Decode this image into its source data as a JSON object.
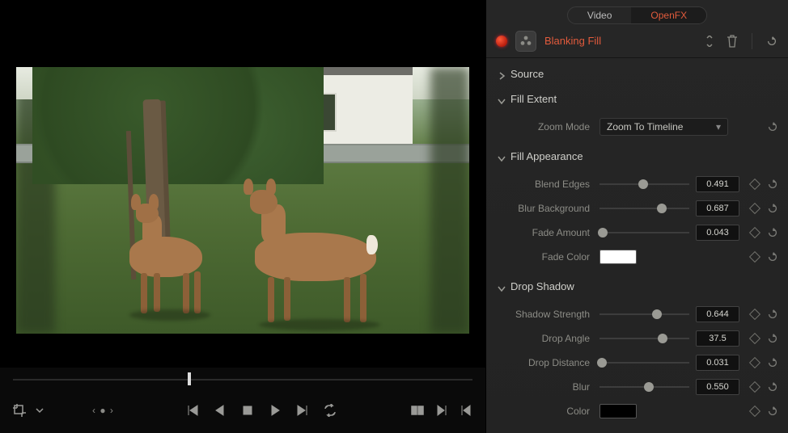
{
  "tabs": {
    "video": "Video",
    "openfx": "OpenFX"
  },
  "effect": {
    "name": "Blanking Fill"
  },
  "sections": {
    "source": {
      "title": "Source",
      "expanded": false
    },
    "fill_extent": {
      "title": "Fill Extent",
      "expanded": true
    },
    "fill_appearance": {
      "title": "Fill Appearance",
      "expanded": true
    },
    "drop_shadow": {
      "title": "Drop Shadow",
      "expanded": true
    }
  },
  "fill_extent": {
    "zoom_mode": {
      "label": "Zoom Mode",
      "value": "Zoom To Timeline"
    }
  },
  "fill_appearance": {
    "blend_edges": {
      "label": "Blend Edges",
      "value": "0.491",
      "pct": 49
    },
    "blur_background": {
      "label": "Blur Background",
      "value": "0.687",
      "pct": 69
    },
    "fade_amount": {
      "label": "Fade Amount",
      "value": "0.043",
      "pct": 4
    },
    "fade_color": {
      "label": "Fade Color",
      "hex": "#ffffff"
    }
  },
  "drop_shadow": {
    "shadow_strength": {
      "label": "Shadow Strength",
      "value": "0.644",
      "pct": 64
    },
    "drop_angle": {
      "label": "Drop Angle",
      "value": "37.5",
      "pct": 70
    },
    "drop_distance": {
      "label": "Drop Distance",
      "value": "0.031",
      "pct": 3
    },
    "blur": {
      "label": "Blur",
      "value": "0.550",
      "pct": 55
    },
    "color": {
      "label": "Color",
      "hex": "#000000"
    }
  },
  "timeline": {
    "playhead_pct": 38
  }
}
